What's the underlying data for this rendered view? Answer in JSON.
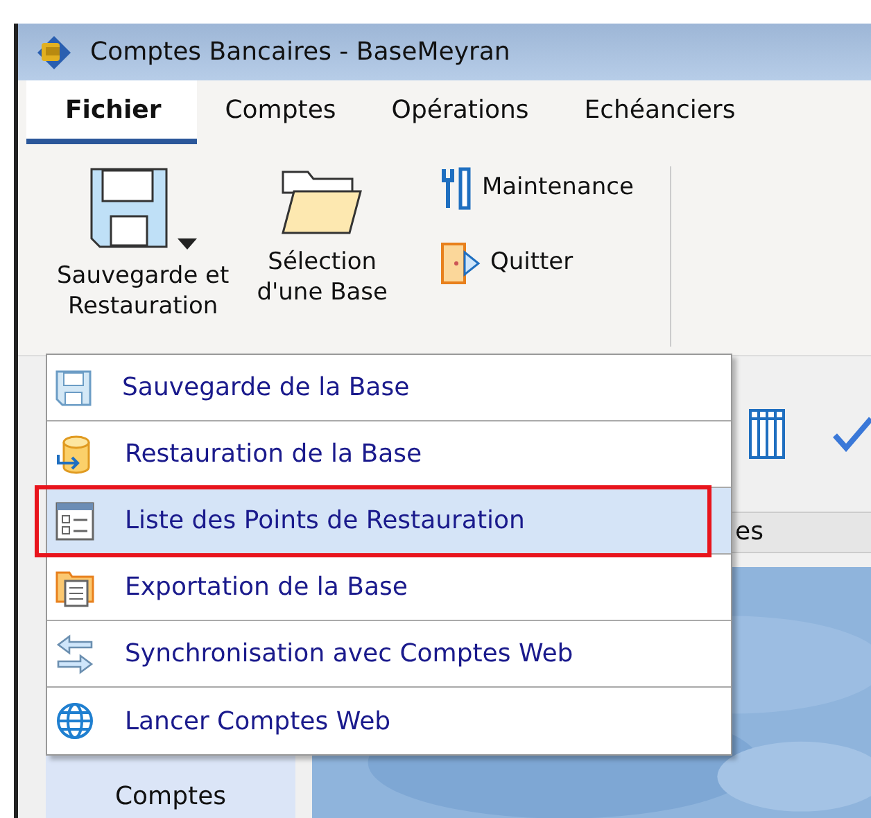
{
  "window": {
    "title": "Comptes Bancaires - BaseMeyran"
  },
  "menu_tabs": [
    {
      "label": "Fichier",
      "selected": true
    },
    {
      "label": "Comptes",
      "selected": false
    },
    {
      "label": "Opérations",
      "selected": false
    },
    {
      "label": "Echéanciers",
      "selected": false
    }
  ],
  "ribbon": {
    "large_buttons": [
      {
        "kind": "save",
        "label": "Sauvegarde et\nRestauration",
        "dropdown": true
      },
      {
        "kind": "folder",
        "label": "Sélection\nd'une Base",
        "dropdown": false
      }
    ],
    "small_buttons": [
      {
        "kind": "tools",
        "label": "Maintenance"
      },
      {
        "kind": "exit",
        "label": "Quitter"
      }
    ]
  },
  "column_header": "es",
  "sidebar": {
    "label": "Comptes"
  },
  "dropdown_menu": [
    {
      "kind": "save",
      "label": "Sauvegarde de la Base",
      "selected": false,
      "annotated": false
    },
    {
      "kind": "restore",
      "label": "Restauration de la Base",
      "selected": false,
      "annotated": false
    },
    {
      "kind": "list",
      "label": "Liste des Points de Restauration",
      "selected": true,
      "annotated": true
    },
    {
      "kind": "export",
      "label": "Exportation de la Base",
      "selected": false,
      "annotated": false
    },
    {
      "kind": "sync",
      "label": "Synchronisation avec Comptes Web",
      "selected": false,
      "annotated": false
    },
    {
      "kind": "globe",
      "label": "Lancer Comptes Web",
      "selected": false,
      "annotated": false
    }
  ]
}
